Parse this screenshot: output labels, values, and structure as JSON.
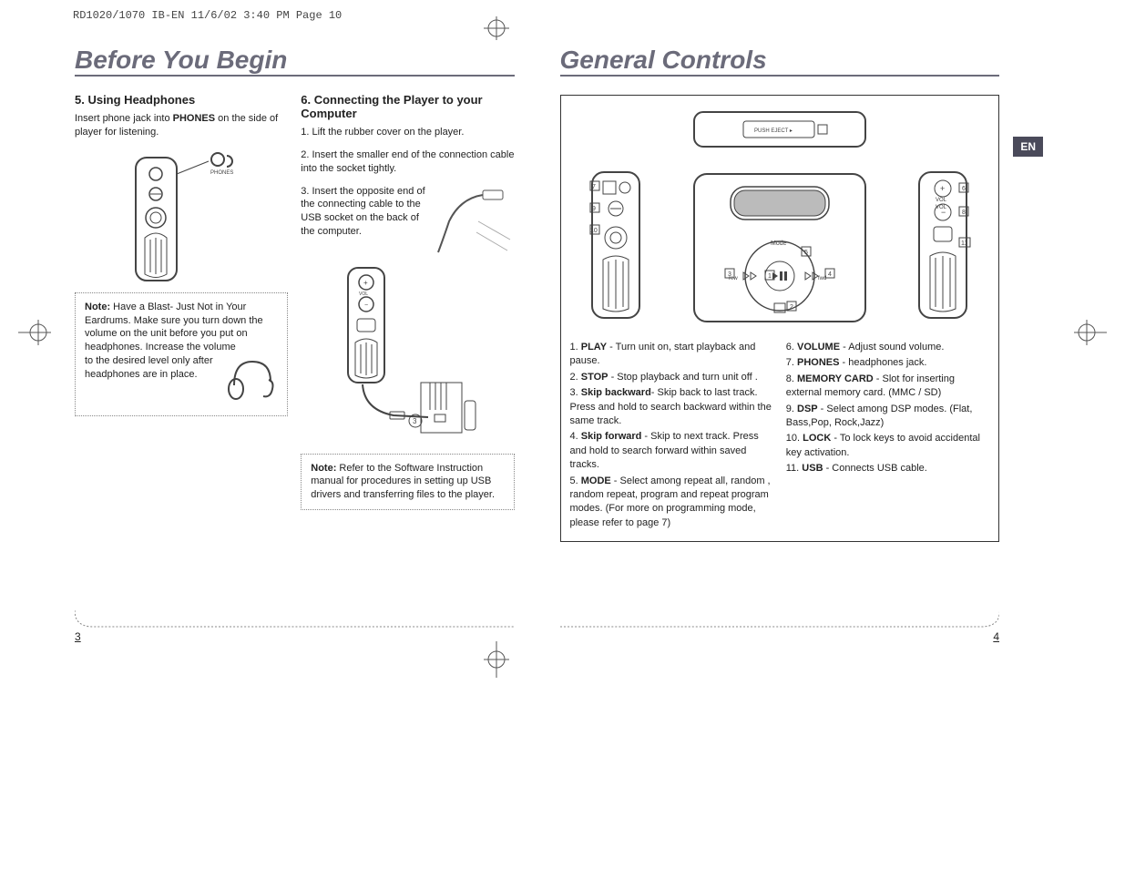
{
  "header_info": "RD1020/1070 IB-EN  11/6/02  3:40 PM  Page 10",
  "left_page": {
    "title": "Before You Begin",
    "section5": {
      "heading": "5. Using Headphones",
      "p1_pre": "Insert phone jack into ",
      "p1_bold": "PHONES",
      "p1_post": " on the side of player for listening.",
      "note_label": "Note:",
      "note_text_top": " Have a Blast- Just Not in Your Eardrums. Make sure you turn down the volume on the unit before you put on headphones. Increase the volume",
      "note_text_side": "to the desired level only after headphones are in place."
    },
    "section6": {
      "heading": "6. Connecting the Player to your Computer",
      "step1": "1. Lift the rubber cover on the player.",
      "step2": "2.  Insert the smaller end of the connection cable into the socket tightly.",
      "step3": "3.  Insert the opposite end of the connecting cable to the USB socket on the back of the computer.",
      "note_label": "Note:",
      "note_text": " Refer to the Software Instruction manual for procedures in setting up USB drivers and transferring files to the player."
    },
    "page_number": "3"
  },
  "right_page": {
    "title": "General Controls",
    "lang_tab": "EN",
    "callouts": [
      "1",
      "2",
      "3",
      "4",
      "5",
      "6",
      "7",
      "8",
      "9",
      "10",
      "11"
    ],
    "controls": [
      {
        "num": "1",
        "name": "PLAY",
        "desc": " - Turn unit on, start playback and pause."
      },
      {
        "num": "2",
        "name": "STOP",
        "desc": " - Stop playback and turn unit off ."
      },
      {
        "num": "3",
        "name": "Skip backward",
        "desc": "- Skip back to last track.  Press and hold to search backward within the same track."
      },
      {
        "num": "4",
        "name": "Skip forward",
        "desc": " - Skip to next track. Press and hold to search forward within saved tracks."
      },
      {
        "num": "5",
        "name": "MODE",
        "desc": " - Select among repeat all, random , random repeat, program and repeat program modes. (For more on programming mode, please refer to page 7)"
      },
      {
        "num": "6",
        "name": "VOLUME",
        "desc": " - Adjust sound volume."
      },
      {
        "num": "7",
        "name": "PHONES",
        "desc": " - headphones jack."
      },
      {
        "num": "8",
        "name": "MEMORY CARD",
        "desc": " - Slot for inserting external memory card. (MMC / SD)"
      },
      {
        "num": "9",
        "name": "DSP",
        "desc": " - Select among DSP modes. (Flat, Bass,Pop, Rock,Jazz)"
      },
      {
        "num": "10",
        "name": "LOCK",
        "desc": " - To lock keys to avoid accidental key activation."
      },
      {
        "num": "11",
        "name": "USB",
        "desc": " - Connects USB cable."
      }
    ],
    "labels": {
      "mode": "Mode",
      "rew": "rew",
      "fwd": "fwd",
      "vol": "VOL",
      "phones": "PHONES",
      "push_eject": "PUSH EJECT"
    },
    "page_number": "4"
  }
}
